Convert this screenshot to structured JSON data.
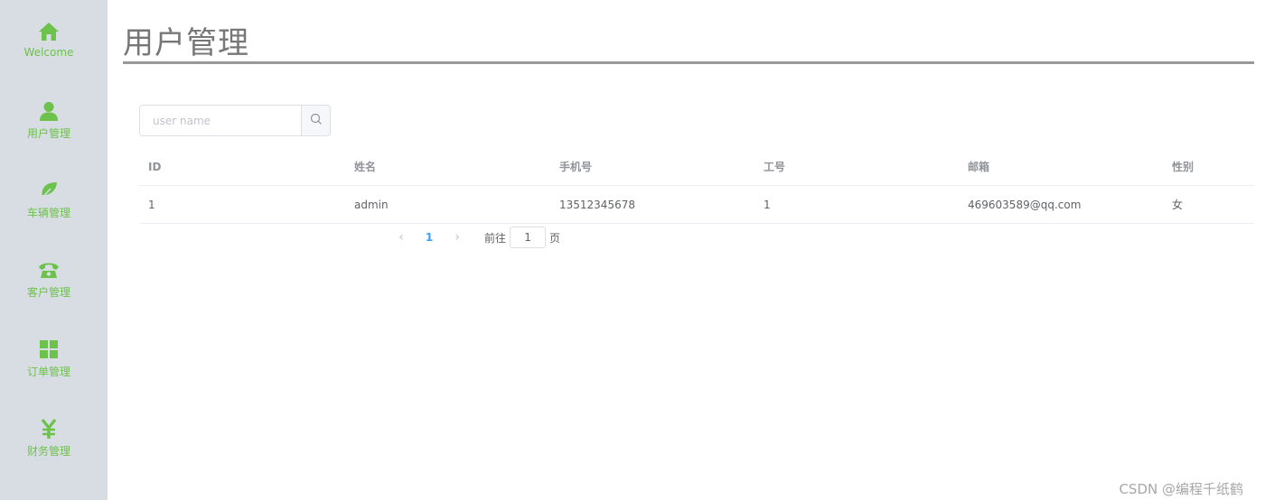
{
  "colors": {
    "accent": "#6cc24a",
    "sidebar_bg": "#d8dde3",
    "link": "#409eff"
  },
  "sidebar": {
    "items": [
      {
        "label": "Welcome",
        "icon": "home-icon"
      },
      {
        "label": "用户管理",
        "icon": "user-icon"
      },
      {
        "label": "车辆管理",
        "icon": "leaf-icon"
      },
      {
        "label": "客户管理",
        "icon": "phone-icon"
      },
      {
        "label": "订单管理",
        "icon": "grid-icon"
      },
      {
        "label": "财务管理",
        "icon": "yen-icon"
      }
    ]
  },
  "page": {
    "title": "用户管理"
  },
  "search": {
    "placeholder": "user name",
    "value": "",
    "button_icon": "search-icon"
  },
  "table": {
    "columns": [
      "ID",
      "姓名",
      "手机号",
      "工号",
      "邮箱",
      "性别"
    ],
    "rows": [
      [
        "1",
        "admin",
        "13512345678",
        "1",
        "469603589@qq.com",
        "女"
      ]
    ]
  },
  "pagination": {
    "prev_icon": "chevron-left-icon",
    "current_page": "1",
    "next_icon": "chevron-right-icon",
    "goto_label": "前往",
    "goto_value": "1",
    "goto_suffix": "页"
  },
  "watermark": "CSDN @编程千纸鹤"
}
